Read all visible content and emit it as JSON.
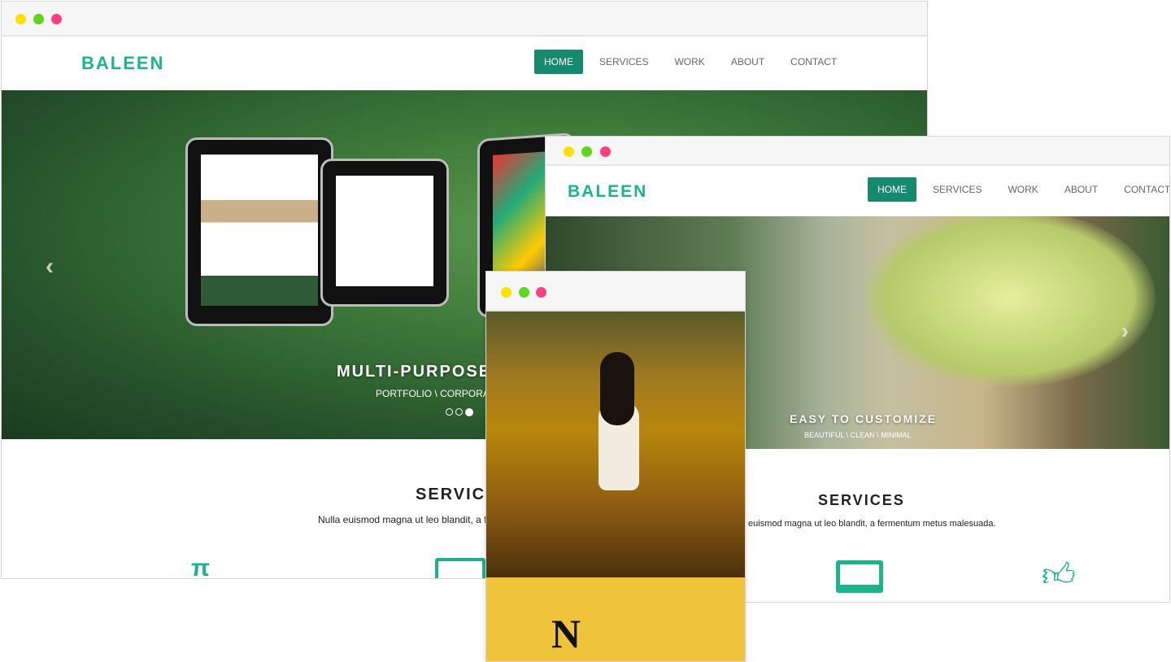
{
  "brand": "BALEEN",
  "nav": [
    "HOME",
    "SERVICES",
    "WORK",
    "ABOUT",
    "CONTACT"
  ],
  "colors": {
    "accent": "#1bb48d",
    "active": "#168a6f",
    "dot_yellow": "#ffe000",
    "dot_green": "#5fd51d",
    "dot_pink": "#ff3f7f"
  },
  "window1": {
    "hero_title": "MULTI-PURPOSE",
    "hero_sub": "PORTFOLIO \\ CORPORAT",
    "slide_indicator": {
      "count": 3,
      "active": 3
    },
    "services_title": "SERVICE",
    "services_text": "Nulla euismod magna ut leo blandit, a fe",
    "icons": [
      "pi-icon",
      "monitor-icon"
    ]
  },
  "window2": {
    "hero_title": "EASY TO CUSTOMIZE",
    "hero_sub": "BEAUTIFUL \\ CLEAN \\ MINIMAL",
    "services_title": "SERVICES",
    "services_text": "euismod magna ut leo blandit, a fermentum metus malesuada.",
    "icons": [
      "monitor-icon",
      "thumbs-up-icon"
    ]
  },
  "window3": {
    "logo_letter": "N"
  }
}
